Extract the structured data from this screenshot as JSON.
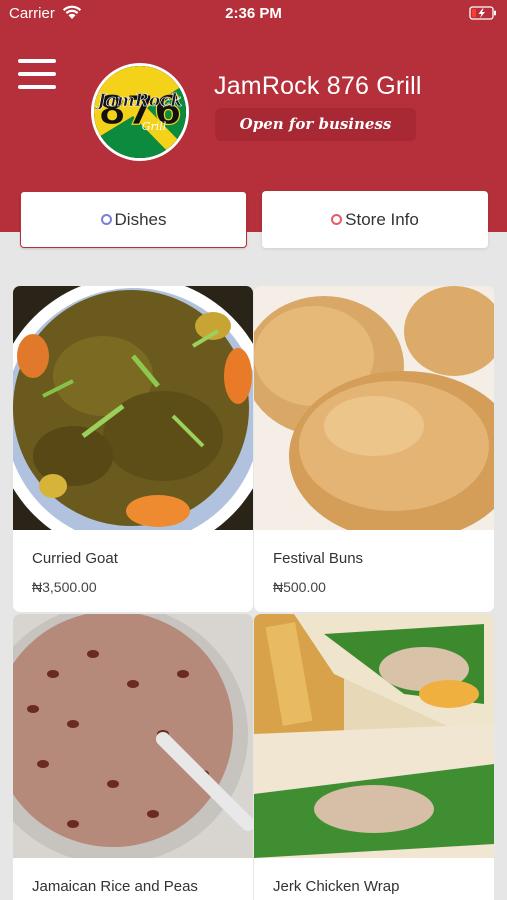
{
  "status_bar": {
    "carrier": "Carrier",
    "time": "2:36 PM"
  },
  "store": {
    "name": "JamRock 876 Grill",
    "status": "Open for business",
    "logo_text": "JamRock Grill 876"
  },
  "tabs": [
    {
      "label": "Dishes",
      "active": true
    },
    {
      "label": "Store Info",
      "active": false
    }
  ],
  "dishes": [
    {
      "name": "Curried Goat",
      "price": "₦3,500.00",
      "image": "curried-goat-image"
    },
    {
      "name": "Festival Buns",
      "price": "₦500.00",
      "image": "festival-buns-image"
    },
    {
      "name": "Jamaican Rice and Peas",
      "price": "",
      "image": "rice-and-peas-image"
    },
    {
      "name": "Jerk Chicken Wrap",
      "price": "",
      "image": "jerk-chicken-wrap-image"
    }
  ],
  "colors": {
    "brand_red": "#b5303a",
    "pill_red": "#a82833",
    "background": "#e6e6e6"
  }
}
